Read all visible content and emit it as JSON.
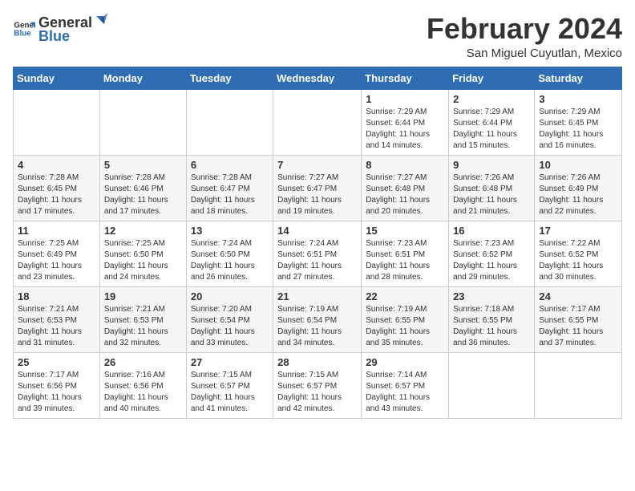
{
  "header": {
    "logo": {
      "general": "General",
      "blue": "Blue"
    },
    "title": "February 2024",
    "location": "San Miguel Cuyutlan, Mexico"
  },
  "calendar": {
    "days_of_week": [
      "Sunday",
      "Monday",
      "Tuesday",
      "Wednesday",
      "Thursday",
      "Friday",
      "Saturday"
    ],
    "weeks": [
      [
        {
          "day": "",
          "info": ""
        },
        {
          "day": "",
          "info": ""
        },
        {
          "day": "",
          "info": ""
        },
        {
          "day": "",
          "info": ""
        },
        {
          "day": "1",
          "info": "Sunrise: 7:29 AM\nSunset: 6:44 PM\nDaylight: 11 hours\nand 14 minutes."
        },
        {
          "day": "2",
          "info": "Sunrise: 7:29 AM\nSunset: 6:44 PM\nDaylight: 11 hours\nand 15 minutes."
        },
        {
          "day": "3",
          "info": "Sunrise: 7:29 AM\nSunset: 6:45 PM\nDaylight: 11 hours\nand 16 minutes."
        }
      ],
      [
        {
          "day": "4",
          "info": "Sunrise: 7:28 AM\nSunset: 6:45 PM\nDaylight: 11 hours\nand 17 minutes."
        },
        {
          "day": "5",
          "info": "Sunrise: 7:28 AM\nSunset: 6:46 PM\nDaylight: 11 hours\nand 17 minutes."
        },
        {
          "day": "6",
          "info": "Sunrise: 7:28 AM\nSunset: 6:47 PM\nDaylight: 11 hours\nand 18 minutes."
        },
        {
          "day": "7",
          "info": "Sunrise: 7:27 AM\nSunset: 6:47 PM\nDaylight: 11 hours\nand 19 minutes."
        },
        {
          "day": "8",
          "info": "Sunrise: 7:27 AM\nSunset: 6:48 PM\nDaylight: 11 hours\nand 20 minutes."
        },
        {
          "day": "9",
          "info": "Sunrise: 7:26 AM\nSunset: 6:48 PM\nDaylight: 11 hours\nand 21 minutes."
        },
        {
          "day": "10",
          "info": "Sunrise: 7:26 AM\nSunset: 6:49 PM\nDaylight: 11 hours\nand 22 minutes."
        }
      ],
      [
        {
          "day": "11",
          "info": "Sunrise: 7:25 AM\nSunset: 6:49 PM\nDaylight: 11 hours\nand 23 minutes."
        },
        {
          "day": "12",
          "info": "Sunrise: 7:25 AM\nSunset: 6:50 PM\nDaylight: 11 hours\nand 24 minutes."
        },
        {
          "day": "13",
          "info": "Sunrise: 7:24 AM\nSunset: 6:50 PM\nDaylight: 11 hours\nand 26 minutes."
        },
        {
          "day": "14",
          "info": "Sunrise: 7:24 AM\nSunset: 6:51 PM\nDaylight: 11 hours\nand 27 minutes."
        },
        {
          "day": "15",
          "info": "Sunrise: 7:23 AM\nSunset: 6:51 PM\nDaylight: 11 hours\nand 28 minutes."
        },
        {
          "day": "16",
          "info": "Sunrise: 7:23 AM\nSunset: 6:52 PM\nDaylight: 11 hours\nand 29 minutes."
        },
        {
          "day": "17",
          "info": "Sunrise: 7:22 AM\nSunset: 6:52 PM\nDaylight: 11 hours\nand 30 minutes."
        }
      ],
      [
        {
          "day": "18",
          "info": "Sunrise: 7:21 AM\nSunset: 6:53 PM\nDaylight: 11 hours\nand 31 minutes."
        },
        {
          "day": "19",
          "info": "Sunrise: 7:21 AM\nSunset: 6:53 PM\nDaylight: 11 hours\nand 32 minutes."
        },
        {
          "day": "20",
          "info": "Sunrise: 7:20 AM\nSunset: 6:54 PM\nDaylight: 11 hours\nand 33 minutes."
        },
        {
          "day": "21",
          "info": "Sunrise: 7:19 AM\nSunset: 6:54 PM\nDaylight: 11 hours\nand 34 minutes."
        },
        {
          "day": "22",
          "info": "Sunrise: 7:19 AM\nSunset: 6:55 PM\nDaylight: 11 hours\nand 35 minutes."
        },
        {
          "day": "23",
          "info": "Sunrise: 7:18 AM\nSunset: 6:55 PM\nDaylight: 11 hours\nand 36 minutes."
        },
        {
          "day": "24",
          "info": "Sunrise: 7:17 AM\nSunset: 6:55 PM\nDaylight: 11 hours\nand 37 minutes."
        }
      ],
      [
        {
          "day": "25",
          "info": "Sunrise: 7:17 AM\nSunset: 6:56 PM\nDaylight: 11 hours\nand 39 minutes."
        },
        {
          "day": "26",
          "info": "Sunrise: 7:16 AM\nSunset: 6:56 PM\nDaylight: 11 hours\nand 40 minutes."
        },
        {
          "day": "27",
          "info": "Sunrise: 7:15 AM\nSunset: 6:57 PM\nDaylight: 11 hours\nand 41 minutes."
        },
        {
          "day": "28",
          "info": "Sunrise: 7:15 AM\nSunset: 6:57 PM\nDaylight: 11 hours\nand 42 minutes."
        },
        {
          "day": "29",
          "info": "Sunrise: 7:14 AM\nSunset: 6:57 PM\nDaylight: 11 hours\nand 43 minutes."
        },
        {
          "day": "",
          "info": ""
        },
        {
          "day": "",
          "info": ""
        }
      ]
    ]
  }
}
